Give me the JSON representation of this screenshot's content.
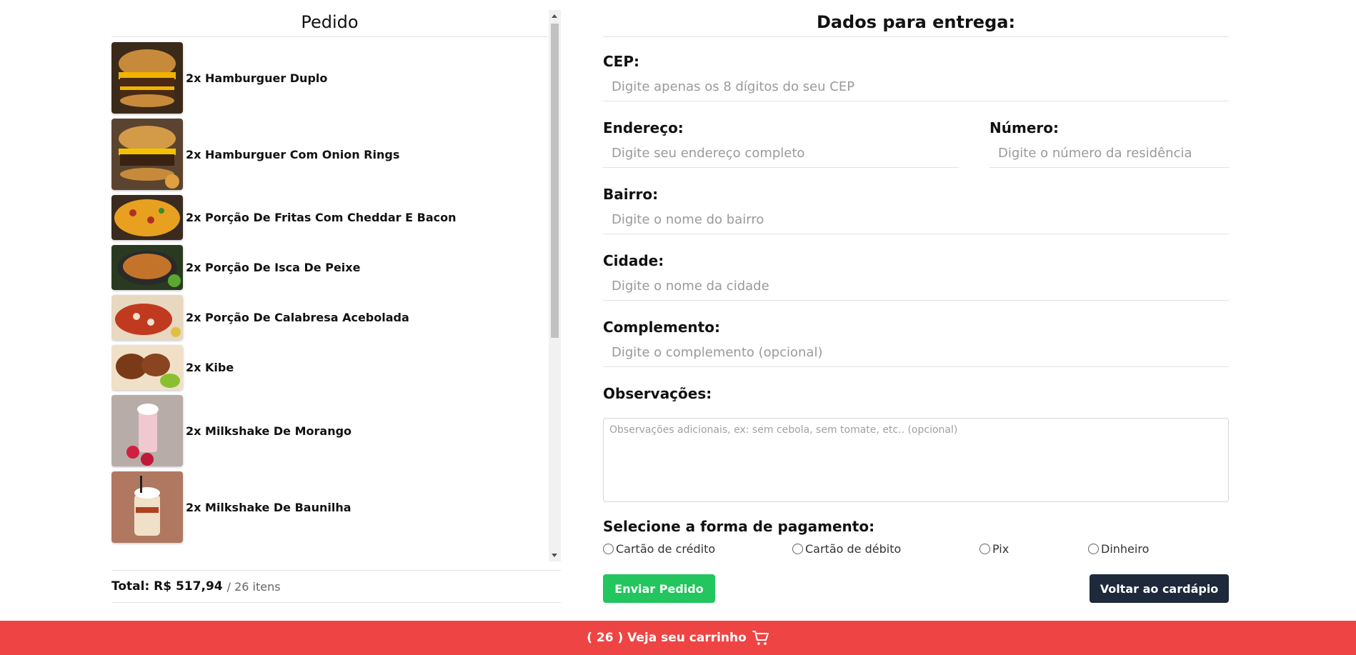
{
  "order": {
    "title": "Pedido",
    "items": [
      {
        "label": "2x Hamburguer Duplo"
      },
      {
        "label": "2x Hamburguer Com Onion Rings"
      },
      {
        "label": "2x Porção De Fritas Com Cheddar E Bacon"
      },
      {
        "label": "2x Porção De Isca De Peixe"
      },
      {
        "label": "2x Porção De Calabresa Acebolada"
      },
      {
        "label": "2x Kibe"
      },
      {
        "label": "2x Milkshake De Morango"
      },
      {
        "label": "2x Milkshake De Baunilha"
      }
    ],
    "total_label": "Total: R$ 517,94",
    "total_count": "/ 26 itens"
  },
  "delivery": {
    "title": "Dados para entrega:",
    "cep": {
      "label": "CEP:",
      "placeholder": "Digite apenas os 8 dígitos do seu CEP"
    },
    "endereco": {
      "label": "Endereço:",
      "placeholder": "Digite seu endereço completo"
    },
    "numero": {
      "label": "Número:",
      "placeholder": "Digite o número da residência"
    },
    "bairro": {
      "label": "Bairro:",
      "placeholder": "Digite o nome do bairro"
    },
    "cidade": {
      "label": "Cidade:",
      "placeholder": "Digite o nome da cidade"
    },
    "complemento": {
      "label": "Complemento:",
      "placeholder": "Digite o complemento (opcional)"
    },
    "observacoes": {
      "label": "Observações:",
      "placeholder": "Observações adicionais, ex: sem cebola, sem tomate, etc.. (opcional)"
    },
    "payment_title": "Selecione a forma de pagamento:",
    "payment_options": [
      "Cartão de crédito",
      "Cartão de débito",
      "Pix",
      "Dinheiro"
    ],
    "send_button": "Enviar Pedido",
    "back_button": "Voltar ao cardápio"
  },
  "footer": {
    "cart_label": "( 26 ) Veja seu carrinho",
    "icon": "cart-icon"
  },
  "colors": {
    "footer_bg": "#ef4444",
    "send_bg": "#22c55e",
    "back_bg": "#1e293b"
  }
}
